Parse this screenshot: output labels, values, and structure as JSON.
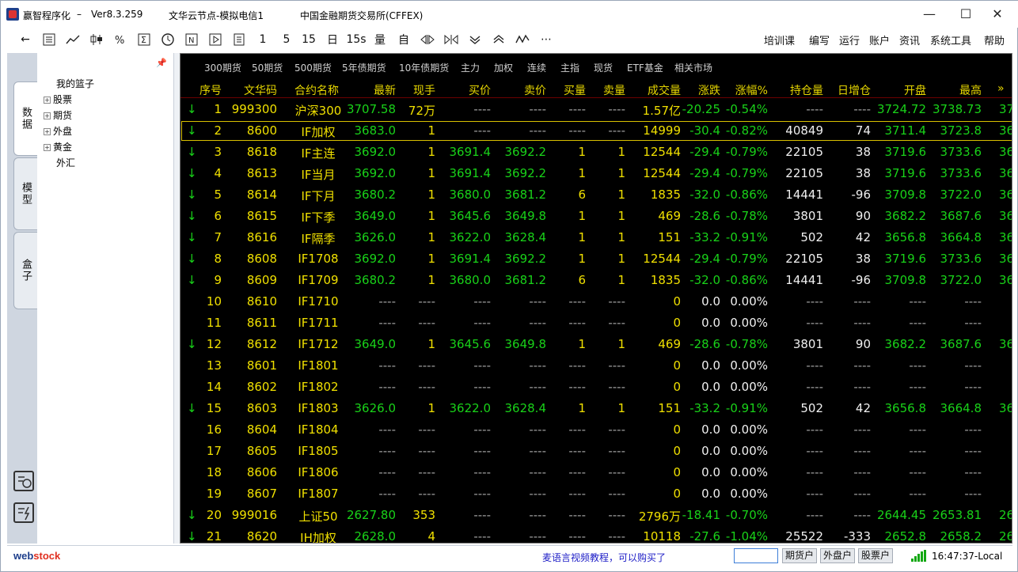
{
  "window": {
    "app_title": "赢智程序化",
    "version": "Ver8.3.259",
    "server": "文华云节点-模拟电信1",
    "exchange": "中国金融期货交易所(CFFEX)"
  },
  "toolbar": {
    "text_buttons": [
      "1",
      "5",
      "15",
      "日",
      "15s",
      "量",
      "自"
    ],
    "menus": [
      "培训课",
      "编写",
      "运行",
      "账户",
      "资讯",
      "系统工具",
      "帮助"
    ]
  },
  "left_tabs": [
    "数据",
    "模型",
    "盒子"
  ],
  "tree": {
    "root": "我的篮子",
    "items": [
      "股票",
      "期货",
      "外盘",
      "黄金",
      "外汇"
    ]
  },
  "market": {
    "subtabs": [
      "300期货",
      "50期货",
      "500期货",
      "5年债期货",
      "10年债期货",
      "主力",
      "加权",
      "连续",
      "主指",
      "现货",
      "ETF基金",
      "相关市场"
    ],
    "columns": [
      "序号",
      "文华码",
      "合约名称",
      "最新",
      "现手",
      "买价",
      "卖价",
      "买量",
      "卖量",
      "成交量",
      "涨跌",
      "涨幅%",
      "持仓量",
      "日增仓",
      "开盘",
      "最高",
      "»"
    ],
    "rows": [
      {
        "arrow": "↓",
        "seq": "1",
        "code": "999300",
        "name": "沪深300",
        "last": "3707.58",
        "hand": "72万",
        "bid": "----",
        "ask": "----",
        "bidv": "----",
        "askv": "----",
        "vol": "1.57亿",
        "chg": "-20.25",
        "pct": "-0.54%",
        "oi": "----",
        "oichg": "----",
        "open": "3724.72",
        "high": "3738.73",
        "more": "37"
      },
      {
        "arrow": "↓",
        "seq": "2",
        "code": "8600",
        "name": "IF加权",
        "last": "3683.0",
        "hand": "1",
        "bid": "----",
        "ask": "----",
        "bidv": "----",
        "askv": "----",
        "vol": "14999",
        "chg": "-30.4",
        "pct": "-0.82%",
        "oi": "40849",
        "oichg": "74",
        "open": "3711.4",
        "high": "3723.8",
        "more": "36"
      },
      {
        "arrow": "↓",
        "seq": "3",
        "code": "8618",
        "name": "IF主连",
        "last": "3692.0",
        "hand": "1",
        "bid": "3691.4",
        "ask": "3692.2",
        "bidv": "1",
        "askv": "1",
        "vol": "12544",
        "chg": "-29.4",
        "pct": "-0.79%",
        "oi": "22105",
        "oichg": "38",
        "open": "3719.6",
        "high": "3733.6",
        "more": "36"
      },
      {
        "arrow": "↓",
        "seq": "4",
        "code": "8613",
        "name": "IF当月",
        "last": "3692.0",
        "hand": "1",
        "bid": "3691.4",
        "ask": "3692.2",
        "bidv": "1",
        "askv": "1",
        "vol": "12544",
        "chg": "-29.4",
        "pct": "-0.79%",
        "oi": "22105",
        "oichg": "38",
        "open": "3719.6",
        "high": "3733.6",
        "more": "36"
      },
      {
        "arrow": "↓",
        "seq": "5",
        "code": "8614",
        "name": "IF下月",
        "last": "3680.2",
        "hand": "1",
        "bid": "3680.0",
        "ask": "3681.2",
        "bidv": "6",
        "askv": "1",
        "vol": "1835",
        "chg": "-32.0",
        "pct": "-0.86%",
        "oi": "14441",
        "oichg": "-96",
        "open": "3709.8",
        "high": "3722.0",
        "more": "36"
      },
      {
        "arrow": "↓",
        "seq": "6",
        "code": "8615",
        "name": "IF下季",
        "last": "3649.0",
        "hand": "1",
        "bid": "3645.6",
        "ask": "3649.8",
        "bidv": "1",
        "askv": "1",
        "vol": "469",
        "chg": "-28.6",
        "pct": "-0.78%",
        "oi": "3801",
        "oichg": "90",
        "open": "3682.2",
        "high": "3687.6",
        "more": "36"
      },
      {
        "arrow": "↓",
        "seq": "7",
        "code": "8616",
        "name": "IF隔季",
        "last": "3626.0",
        "hand": "1",
        "bid": "3622.0",
        "ask": "3628.4",
        "bidv": "1",
        "askv": "1",
        "vol": "151",
        "chg": "-33.2",
        "pct": "-0.91%",
        "oi": "502",
        "oichg": "42",
        "open": "3656.8",
        "high": "3664.8",
        "more": "36"
      },
      {
        "arrow": "↓",
        "seq": "8",
        "code": "8608",
        "name": "IF1708",
        "last": "3692.0",
        "hand": "1",
        "bid": "3691.4",
        "ask": "3692.2",
        "bidv": "1",
        "askv": "1",
        "vol": "12544",
        "chg": "-29.4",
        "pct": "-0.79%",
        "oi": "22105",
        "oichg": "38",
        "open": "3719.6",
        "high": "3733.6",
        "more": "36"
      },
      {
        "arrow": "↓",
        "seq": "9",
        "code": "8609",
        "name": "IF1709",
        "last": "3680.2",
        "hand": "1",
        "bid": "3680.0",
        "ask": "3681.2",
        "bidv": "6",
        "askv": "1",
        "vol": "1835",
        "chg": "-32.0",
        "pct": "-0.86%",
        "oi": "14441",
        "oichg": "-96",
        "open": "3709.8",
        "high": "3722.0",
        "more": "36"
      },
      {
        "arrow": "",
        "seq": "10",
        "code": "8610",
        "name": "IF1710",
        "last": "----",
        "hand": "----",
        "bid": "----",
        "ask": "----",
        "bidv": "----",
        "askv": "----",
        "vol": "0",
        "chg": "0.0",
        "pct": "0.00%",
        "oi": "----",
        "oichg": "----",
        "open": "----",
        "high": "----",
        "more": ""
      },
      {
        "arrow": "",
        "seq": "11",
        "code": "8611",
        "name": "IF1711",
        "last": "----",
        "hand": "----",
        "bid": "----",
        "ask": "----",
        "bidv": "----",
        "askv": "----",
        "vol": "0",
        "chg": "0.0",
        "pct": "0.00%",
        "oi": "----",
        "oichg": "----",
        "open": "----",
        "high": "----",
        "more": ""
      },
      {
        "arrow": "↓",
        "seq": "12",
        "code": "8612",
        "name": "IF1712",
        "last": "3649.0",
        "hand": "1",
        "bid": "3645.6",
        "ask": "3649.8",
        "bidv": "1",
        "askv": "1",
        "vol": "469",
        "chg": "-28.6",
        "pct": "-0.78%",
        "oi": "3801",
        "oichg": "90",
        "open": "3682.2",
        "high": "3687.6",
        "more": "36"
      },
      {
        "arrow": "",
        "seq": "13",
        "code": "8601",
        "name": "IF1801",
        "last": "----",
        "hand": "----",
        "bid": "----",
        "ask": "----",
        "bidv": "----",
        "askv": "----",
        "vol": "0",
        "chg": "0.0",
        "pct": "0.00%",
        "oi": "----",
        "oichg": "----",
        "open": "----",
        "high": "----",
        "more": ""
      },
      {
        "arrow": "",
        "seq": "14",
        "code": "8602",
        "name": "IF1802",
        "last": "----",
        "hand": "----",
        "bid": "----",
        "ask": "----",
        "bidv": "----",
        "askv": "----",
        "vol": "0",
        "chg": "0.0",
        "pct": "0.00%",
        "oi": "----",
        "oichg": "----",
        "open": "----",
        "high": "----",
        "more": ""
      },
      {
        "arrow": "↓",
        "seq": "15",
        "code": "8603",
        "name": "IF1803",
        "last": "3626.0",
        "hand": "1",
        "bid": "3622.0",
        "ask": "3628.4",
        "bidv": "1",
        "askv": "1",
        "vol": "151",
        "chg": "-33.2",
        "pct": "-0.91%",
        "oi": "502",
        "oichg": "42",
        "open": "3656.8",
        "high": "3664.8",
        "more": "36"
      },
      {
        "arrow": "",
        "seq": "16",
        "code": "8604",
        "name": "IF1804",
        "last": "----",
        "hand": "----",
        "bid": "----",
        "ask": "----",
        "bidv": "----",
        "askv": "----",
        "vol": "0",
        "chg": "0.0",
        "pct": "0.00%",
        "oi": "----",
        "oichg": "----",
        "open": "----",
        "high": "----",
        "more": ""
      },
      {
        "arrow": "",
        "seq": "17",
        "code": "8605",
        "name": "IF1805",
        "last": "----",
        "hand": "----",
        "bid": "----",
        "ask": "----",
        "bidv": "----",
        "askv": "----",
        "vol": "0",
        "chg": "0.0",
        "pct": "0.00%",
        "oi": "----",
        "oichg": "----",
        "open": "----",
        "high": "----",
        "more": ""
      },
      {
        "arrow": "",
        "seq": "18",
        "code": "8606",
        "name": "IF1806",
        "last": "----",
        "hand": "----",
        "bid": "----",
        "ask": "----",
        "bidv": "----",
        "askv": "----",
        "vol": "0",
        "chg": "0.0",
        "pct": "0.00%",
        "oi": "----",
        "oichg": "----",
        "open": "----",
        "high": "----",
        "more": ""
      },
      {
        "arrow": "",
        "seq": "19",
        "code": "8607",
        "name": "IF1807",
        "last": "----",
        "hand": "----",
        "bid": "----",
        "ask": "----",
        "bidv": "----",
        "askv": "----",
        "vol": "0",
        "chg": "0.0",
        "pct": "0.00%",
        "oi": "----",
        "oichg": "----",
        "open": "----",
        "high": "----",
        "more": ""
      },
      {
        "arrow": "↓",
        "seq": "20",
        "code": "999016",
        "name": "上证50",
        "last": "2627.80",
        "hand": "353",
        "bid": "----",
        "ask": "----",
        "bidv": "----",
        "askv": "----",
        "vol": "2796万",
        "chg": "-18.41",
        "pct": "-0.70%",
        "oi": "----",
        "oichg": "----",
        "open": "2644.45",
        "high": "2653.81",
        "more": "26"
      },
      {
        "arrow": "↓",
        "seq": "21",
        "code": "8620",
        "name": "IH加权",
        "last": "2628.0",
        "hand": "4",
        "bid": "----",
        "ask": "----",
        "bidv": "----",
        "askv": "----",
        "vol": "10118",
        "chg": "-27.6",
        "pct": "-1.04%",
        "oi": "25522",
        "oichg": "-333",
        "open": "2652.8",
        "high": "2658.2",
        "more": "26"
      }
    ]
  },
  "statusbar": {
    "brand_left": "web",
    "brand_right": "stock",
    "marquee": "麦语言视频教程，可以购买了",
    "buttons": [
      "期货户",
      "外盘户",
      "股票户"
    ],
    "clock": "16:47:37-Local"
  }
}
